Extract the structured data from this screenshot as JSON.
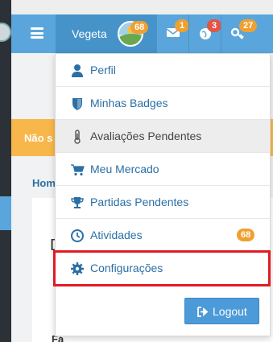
{
  "topbar": {
    "username": "Vegeta",
    "avatar_badge": "68",
    "icons": [
      {
        "name": "envelope-icon",
        "badge": "1",
        "badge_color": "#f0a030"
      },
      {
        "name": "globe-icon",
        "badge": "3",
        "badge_color": "#e25443"
      },
      {
        "name": "key-icon",
        "badge": "27",
        "badge_color": "#f0a030"
      }
    ]
  },
  "background": {
    "alert_text": "Não s",
    "breadcrumb": "Hom",
    "card_letter": "D",
    "card_footer": "Fá"
  },
  "menu": {
    "items": [
      {
        "label": "Perfil",
        "icon": "user-icon"
      },
      {
        "label": "Minhas Badges",
        "icon": "shield-icon"
      },
      {
        "label": "Avaliações Pendentes",
        "icon": "thermometer-icon"
      },
      {
        "label": "Meu Mercado",
        "icon": "cart-icon"
      },
      {
        "label": "Partidas Pendentes",
        "icon": "trophy-icon"
      },
      {
        "label": "Atividades",
        "icon": "clock-icon",
        "badge": "68"
      },
      {
        "label": "Configurações",
        "icon": "gear-icon"
      }
    ],
    "logout_label": "Logout"
  },
  "colors": {
    "topbar": "#5aa6dc",
    "link": "#2a6fa5",
    "highlight": "#e01b24",
    "alert": "#f8b74a"
  }
}
